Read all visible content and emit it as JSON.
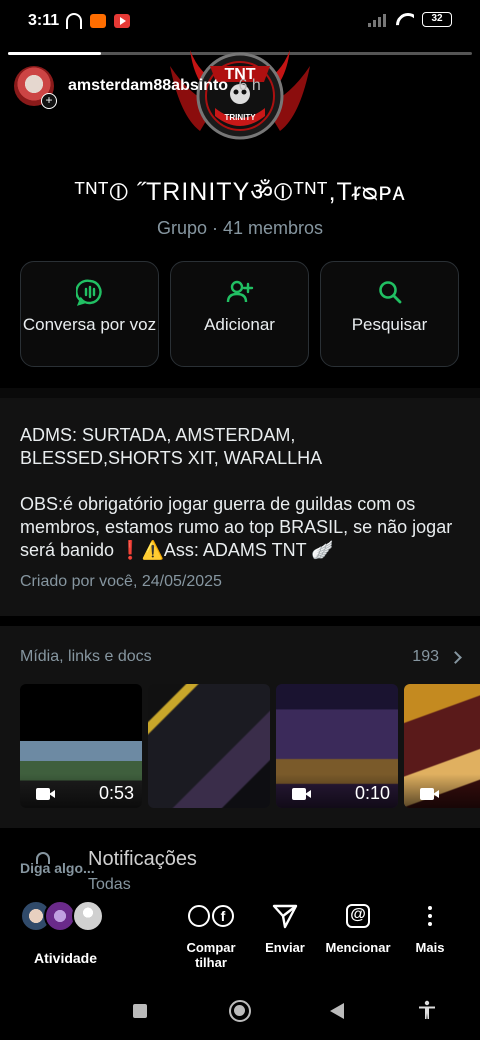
{
  "status_bar": {
    "time": "3:11",
    "battery": "32",
    "icons": [
      "headphones-icon",
      "camera-app-icon",
      "youtube-icon",
      "signal-icon",
      "wifi-icon",
      "battery-icon"
    ]
  },
  "story": {
    "progress_percent": 20,
    "username": "amsterdam88absinto",
    "time_ago": "6 h"
  },
  "group": {
    "logo_text": "TNT",
    "logo_subtext": "TRINITY",
    "name": "ᵀᴺᵀ⦶ ˝TRINITYॐ⦶ᵀᴺᵀ,Tᵲᴓᴘᴀ",
    "meta": "Grupo · 41 membros"
  },
  "actions": [
    {
      "label": "Conversa por voz",
      "icon": "voice-chat-icon"
    },
    {
      "label": "Adicionar",
      "icon": "add-person-icon"
    },
    {
      "label": "Pesquisar",
      "icon": "search-icon"
    }
  ],
  "description": {
    "line1": "ADMS: SURTADA, AMSTERDAM, BLESSED,SHORTS XIT, WARALLHA",
    "line2": "OBS:é obrigatório jogar guerra de guildas com os membros, estamos rumo ao top BRASIL, se não jogar será banido ❗⚠️Ass: ADAMS TNT 🪽",
    "created": "Criado por você, 24/05/2025"
  },
  "media": {
    "title": "Mídia, links e docs",
    "count": "193",
    "thumbs": [
      {
        "duration": "0:53"
      },
      {
        "duration": ""
      },
      {
        "duration": "0:10"
      },
      {
        "duration": ""
      }
    ]
  },
  "overlay": {
    "prompt": "Diga algo...",
    "notif_title": "Notificações",
    "notif_sub": "Todas",
    "activity_label": "Atividade",
    "shortcuts": {
      "share": "Compar tilhar",
      "send": "Enviar",
      "mention": "Mencionar",
      "more": "Mais"
    }
  },
  "colors": {
    "accent_green": "#21c063",
    "background": "#000000",
    "panel": "#121212",
    "muted_text": "#8696a0"
  }
}
